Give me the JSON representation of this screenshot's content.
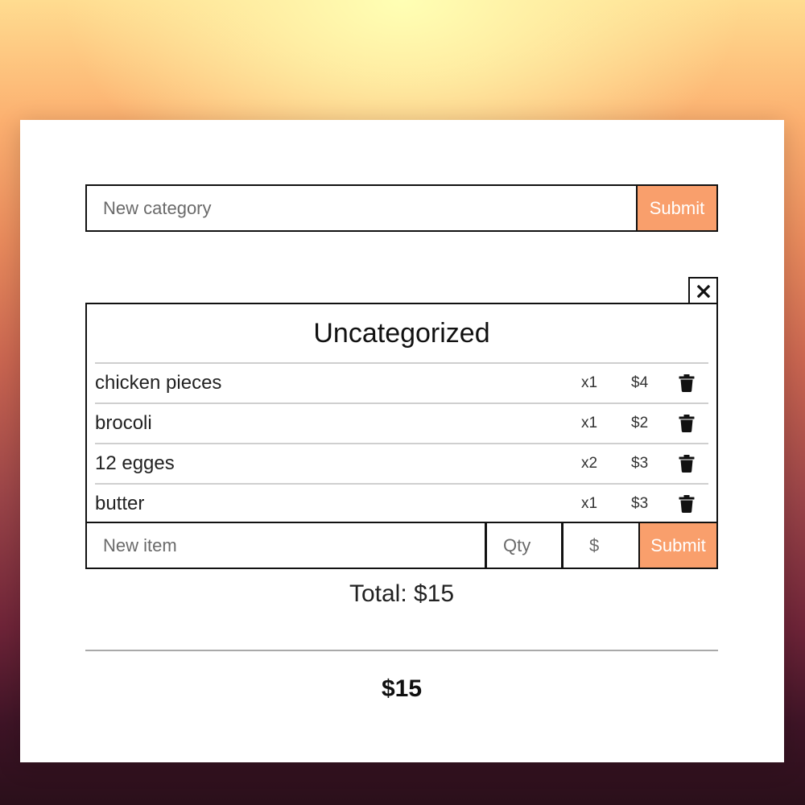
{
  "category_form": {
    "placeholder": "New category",
    "submit_label": "Submit"
  },
  "close_icon": "close-icon",
  "category": {
    "title": "Uncategorized",
    "items": [
      {
        "name": "chicken pieces",
        "qty": "x1",
        "price": "$4"
      },
      {
        "name": "brocoli",
        "qty": "x1",
        "price": "$2"
      },
      {
        "name": "12 egges",
        "qty": "x2",
        "price": "$3"
      },
      {
        "name": "butter",
        "qty": "x1",
        "price": "$3"
      }
    ],
    "item_form": {
      "name_placeholder": "New item",
      "qty_placeholder": "Qty",
      "price_placeholder": "$",
      "submit_label": "Submit"
    },
    "total_text": "Total: $15"
  },
  "grand_total": "$15",
  "colors": {
    "accent": "#f99f6c",
    "border": "#111111",
    "row_divider": "#cfcfcf"
  }
}
